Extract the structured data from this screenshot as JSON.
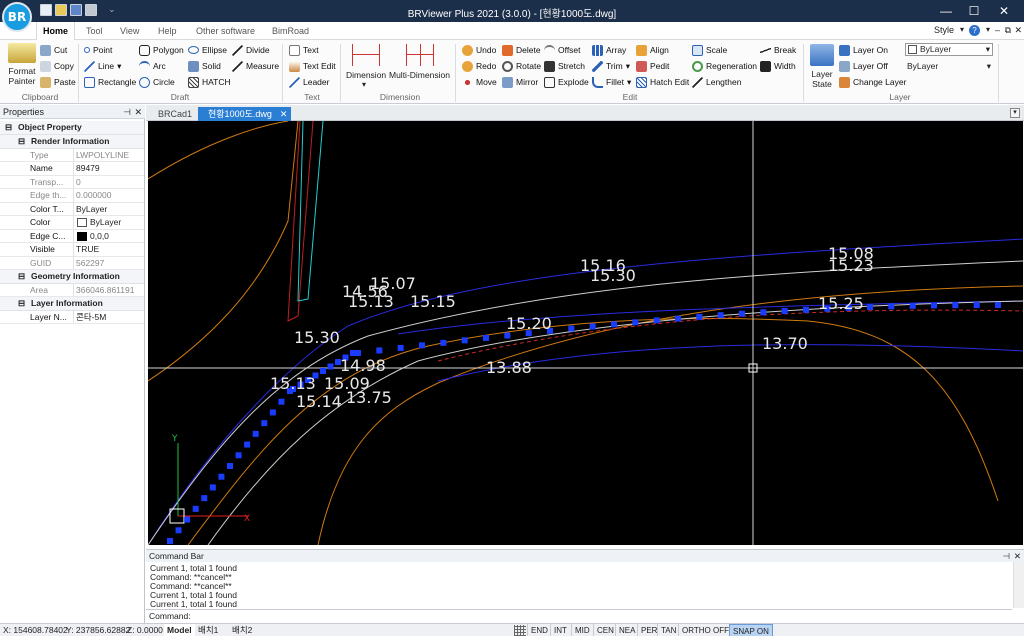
{
  "app": {
    "logo_text": "BR",
    "title": "BRViewer Plus 2021 (3.0.0) - [현황1000도.dwg]"
  },
  "ribbon_tabs": [
    "Home",
    "Tool",
    "View",
    "Help",
    "Other software",
    "BimRoad"
  ],
  "style_label": "Style",
  "help_label": "?",
  "clipboard": {
    "format_painter": "Format Painter",
    "cut": "Cut",
    "copy": "Copy",
    "paste": "Paste",
    "group": "Clipboard"
  },
  "draw": {
    "point": "Point",
    "polygon": "Polygon",
    "ellipse": "Ellipse",
    "divide": "Divide",
    "line": "Line",
    "arc": "Arc",
    "solid": "Solid",
    "measure": "Measure",
    "rectangle": "Rectangle",
    "circle": "Circle",
    "hatch": "HATCH",
    "group": "Draft"
  },
  "text": {
    "text": "Text",
    "text_edit": "Text Edit",
    "leader": "Leader",
    "group": "Text"
  },
  "dimension": {
    "dimension": "Dimension",
    "multi": "Multi-Dimension",
    "group": "Dimension"
  },
  "edit": {
    "undo": "Undo",
    "delete": "Delete",
    "offset": "Offset",
    "array": "Array",
    "align": "Align",
    "scale": "Scale",
    "break": "Break",
    "redo": "Redo",
    "rotate": "Rotate",
    "stretch": "Stretch",
    "trim": "Trim",
    "pedit": "Pedit",
    "regeneration": "Regeneration",
    "width": "Width",
    "move": "Move",
    "mirror": "Mirror",
    "explode": "Explode",
    "fillet": "Fillet",
    "hatch_edit": "Hatch Edit",
    "lengthen": "Lengthen",
    "group": "Edit"
  },
  "layer": {
    "layer_state": "Layer State",
    "layer_on": "Layer On",
    "layer_off": "Layer Off",
    "change_layer": "Change Layer",
    "dropdown_value": "ByLayer",
    "linetype_value": "ByLayer",
    "group": "Layer"
  },
  "properties": {
    "title": "Properties",
    "object_property": "Object Property",
    "render_info": "Render Information",
    "geometry_info": "Geometry Information",
    "layer_info": "Layer Information",
    "rows": [
      {
        "key": "Type",
        "value": "LWPOLYLINE"
      },
      {
        "key": "Name",
        "value": "89479"
      },
      {
        "key": "Transp...",
        "value": "0"
      },
      {
        "key": "Edge th...",
        "value": "0.000000"
      },
      {
        "key": "Color T...",
        "value": "ByLayer"
      },
      {
        "key": "Color",
        "value": "ByLayer"
      },
      {
        "key": "Edge C...",
        "value": "0,0,0"
      },
      {
        "key": "Visible",
        "value": "TRUE"
      },
      {
        "key": "GUID",
        "value": "562297"
      }
    ],
    "geometry_rows": [
      {
        "key": "Area",
        "value": "366046.861191"
      }
    ],
    "layer_rows": [
      {
        "key": "Layer N...",
        "value": "콘타-5M"
      }
    ]
  },
  "doc_tabs": [
    "BRCad1",
    "현황1000도.dwg"
  ],
  "canvas": {
    "labels": [
      "15.07",
      "14.56",
      "15.13",
      "15.15",
      "15.16",
      "15.30",
      "15.08",
      "15.23",
      "15.30",
      "15.20",
      "15.25",
      "14.98",
      "13.88",
      "13.70",
      "15.13",
      "15.09",
      "15.14",
      "13.75"
    ],
    "axis_x": "X",
    "axis_y": "Y"
  },
  "command_bar": {
    "title": "Command Bar",
    "lines": [
      "Current 1, total 1 found",
      "Command:  **cancel**",
      "Command:  **cancel**",
      "Current 1, total 1 found",
      "Current 1, total 1 found"
    ],
    "prompt": "Command:"
  },
  "status": {
    "x": "X: 154608.78402",
    "y": "Y: 237856.62882",
    "z": "Z: 0.0000",
    "layout_tabs": [
      "Model",
      "배치1",
      "배치2"
    ],
    "snaps": [
      "END",
      "INT",
      "MID",
      "CEN",
      "NEA",
      "PER",
      "TAN",
      "ORTHO OFF",
      "SNAP ON"
    ]
  }
}
